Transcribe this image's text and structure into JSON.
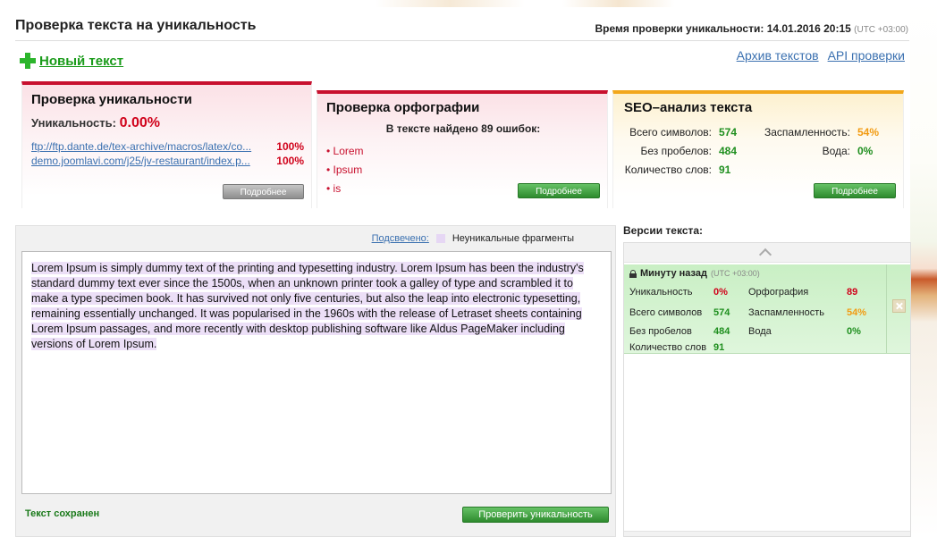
{
  "header": {
    "page_title": "Проверка текста на уникальность",
    "check_time_label": "Время проверки уникальности:",
    "check_time_value": "14.01.2016 20:15",
    "check_time_tz": "(UTC +03:00)",
    "new_text_label": "Новый текст",
    "archive_link": "Архив текстов",
    "api_link": "API проверки"
  },
  "uniqueness_card": {
    "title": "Проверка уникальности",
    "uniq_label": "Уникальность:",
    "uniq_value": "0.00%",
    "sources": [
      {
        "url": "ftp://ftp.dante.de/tex-archive/macros/latex/co...",
        "percent": "100%"
      },
      {
        "url": "demo.joomlavi.com/j25/jv-restaurant/index.p...",
        "percent": "100%"
      }
    ],
    "more_button": "Подробнее"
  },
  "spelling_card": {
    "title": "Проверка орфографии",
    "errors_summary": "В тексте найдено 89 ошибок:",
    "errors": [
      "• Lorem",
      "• Ipsum",
      "• is"
    ],
    "more_button": "Подробнее"
  },
  "seo_card": {
    "title": "SEO–анализ текста",
    "total_chars_label": "Всего символов:",
    "total_chars_value": "574",
    "no_spaces_label": "Без пробелов:",
    "no_spaces_value": "484",
    "word_count_label": "Количество слов:",
    "word_count_value": "91",
    "spam_label": "Заспамленность:",
    "spam_value": "54%",
    "water_label": "Вода:",
    "water_value": "0%",
    "more_button": "Подробнее"
  },
  "editor": {
    "highlight_link": "Подсвечено:",
    "highlight_legend": "Неуникальные фрагменты",
    "text": "Lorem Ipsum is simply dummy text of the printing and typesetting industry. Lorem Ipsum has been the industry's standard dummy text ever since the 1500s, when an unknown printer took a galley of type and scrambled it to make a type specimen book. It has survived not only five centuries, but also the leap into electronic typesetting, remaining essentially unchanged. It was popularised in the 1960s with the release of Letraset sheets containing Lorem Ipsum passages, and more recently with desktop publishing software like Aldus PageMaker including versions of Lorem Ipsum.",
    "saved_status": "Текст сохранен",
    "check_button": "Проверить уникальность"
  },
  "versions": {
    "title": "Версии текста:",
    "items": [
      {
        "time": "Минуту назад",
        "tz": "(UTC +03:00)",
        "uniq_label": "Уникальность",
        "uniq_value": "0%",
        "spelling_label": "Орфография",
        "spelling_value": "89",
        "chars_label": "Всего символов",
        "chars_value": "574",
        "spam_label": "Заспамленность",
        "spam_value": "54%",
        "no_spaces_label": "Без пробелов",
        "no_spaces_value": "484",
        "water_label": "Вода",
        "water_value": "0%",
        "words_label": "Количество слов",
        "words_value": "91"
      }
    ]
  },
  "colors": {
    "accent_green": "#1a9b1a",
    "accent_red": "#c8102e",
    "accent_orange": "#f2a71b",
    "link_blue": "#3a70b0",
    "highlight_purple": "#ecdff7"
  },
  "icons": [
    "plus-icon",
    "lock-icon",
    "chevron-up-icon",
    "delete-icon"
  ]
}
